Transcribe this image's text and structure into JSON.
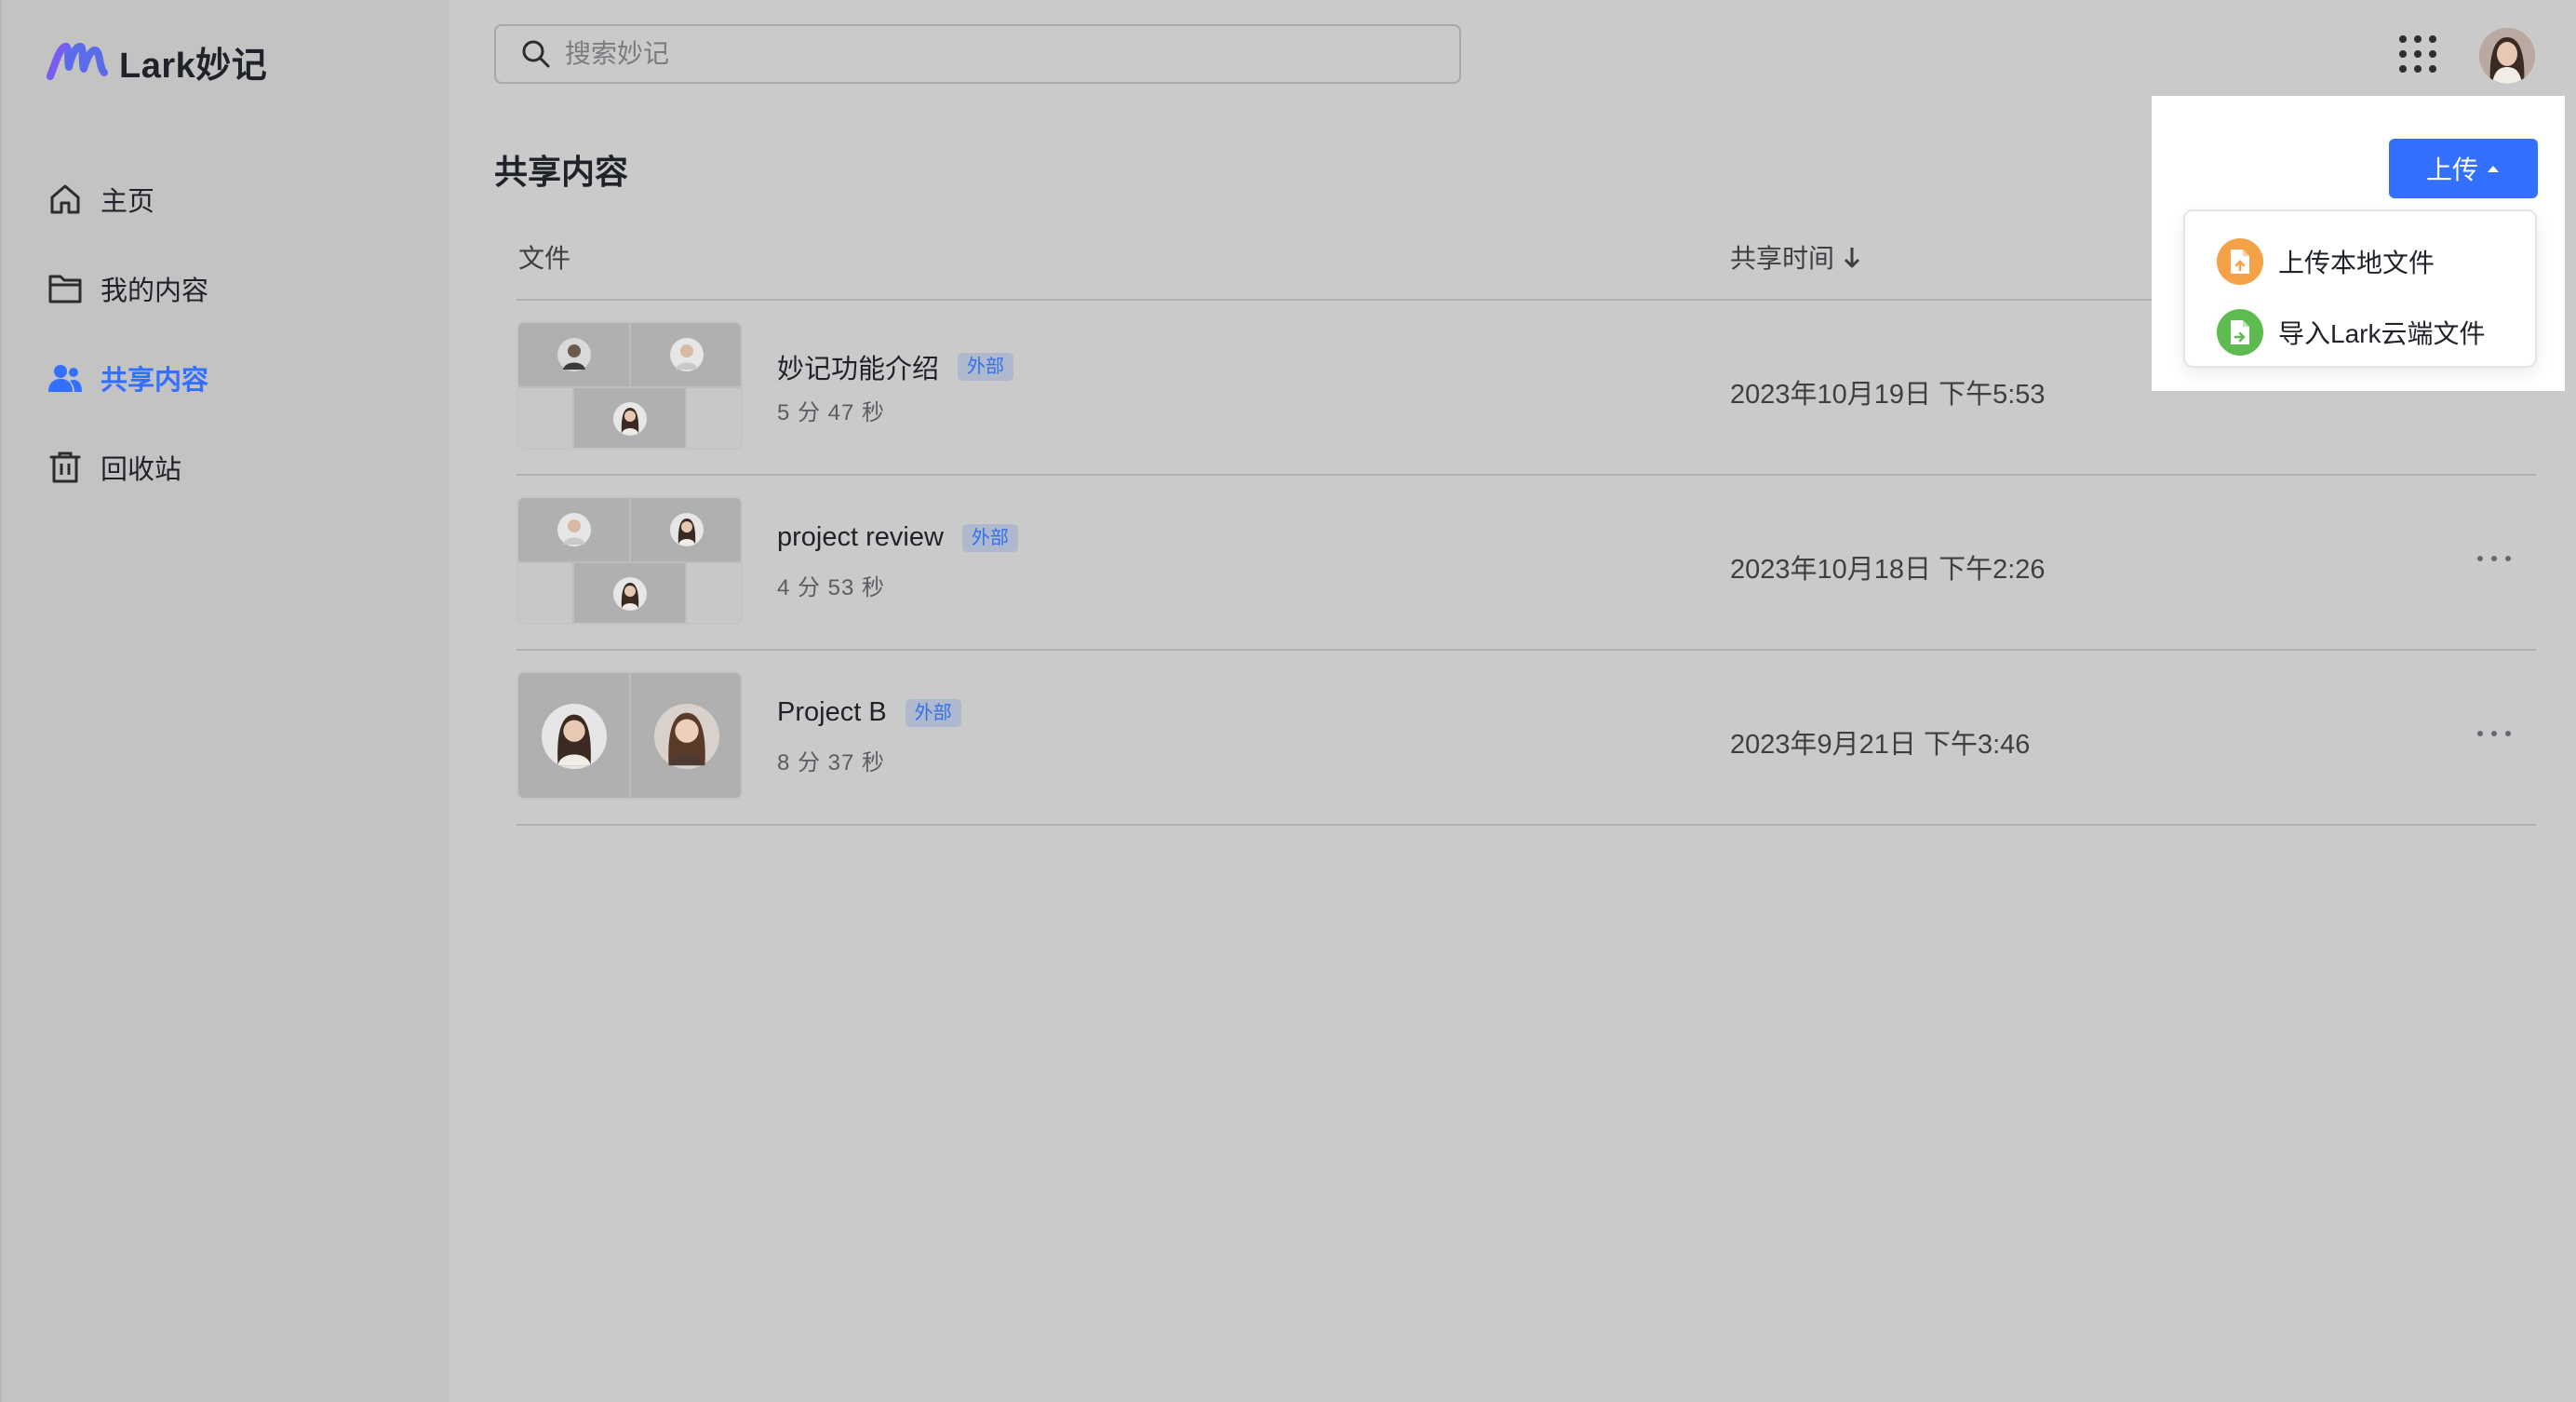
{
  "app": {
    "name": "Lark妙记",
    "brand_color": "#3370ff"
  },
  "search": {
    "placeholder": "搜索妙记",
    "value": ""
  },
  "sidebar": {
    "items": [
      {
        "label": "主页",
        "icon": "home-icon",
        "active": false
      },
      {
        "label": "我的内容",
        "icon": "folder-icon",
        "active": false
      },
      {
        "label": "共享内容",
        "icon": "people-icon",
        "active": true
      },
      {
        "label": "回收站",
        "icon": "trash-icon",
        "active": false
      }
    ]
  },
  "main": {
    "title": "共享内容",
    "columns": {
      "file": "文件",
      "shared_time": "共享时间"
    },
    "rows": [
      {
        "title": "妙记功能介绍",
        "tag": "外部",
        "duration": "5 分 47 秒",
        "shared_time": "2023年10月19日 下午5:53"
      },
      {
        "title": "project review",
        "tag": "外部",
        "duration": "4 分 53 秒",
        "shared_time": "2023年10月18日 下午2:26"
      },
      {
        "title": "Project B",
        "tag": "外部",
        "duration": "8 分 37 秒",
        "shared_time": "2023年9月21日 下午3:46"
      }
    ]
  },
  "upload": {
    "button_label": "上传",
    "menu": [
      {
        "label": "上传本地文件",
        "icon": "local-file-icon",
        "color": "#f5a147"
      },
      {
        "label": "导入Lark云端文件",
        "icon": "cloud-file-icon",
        "color": "#5dbb4f"
      }
    ]
  }
}
